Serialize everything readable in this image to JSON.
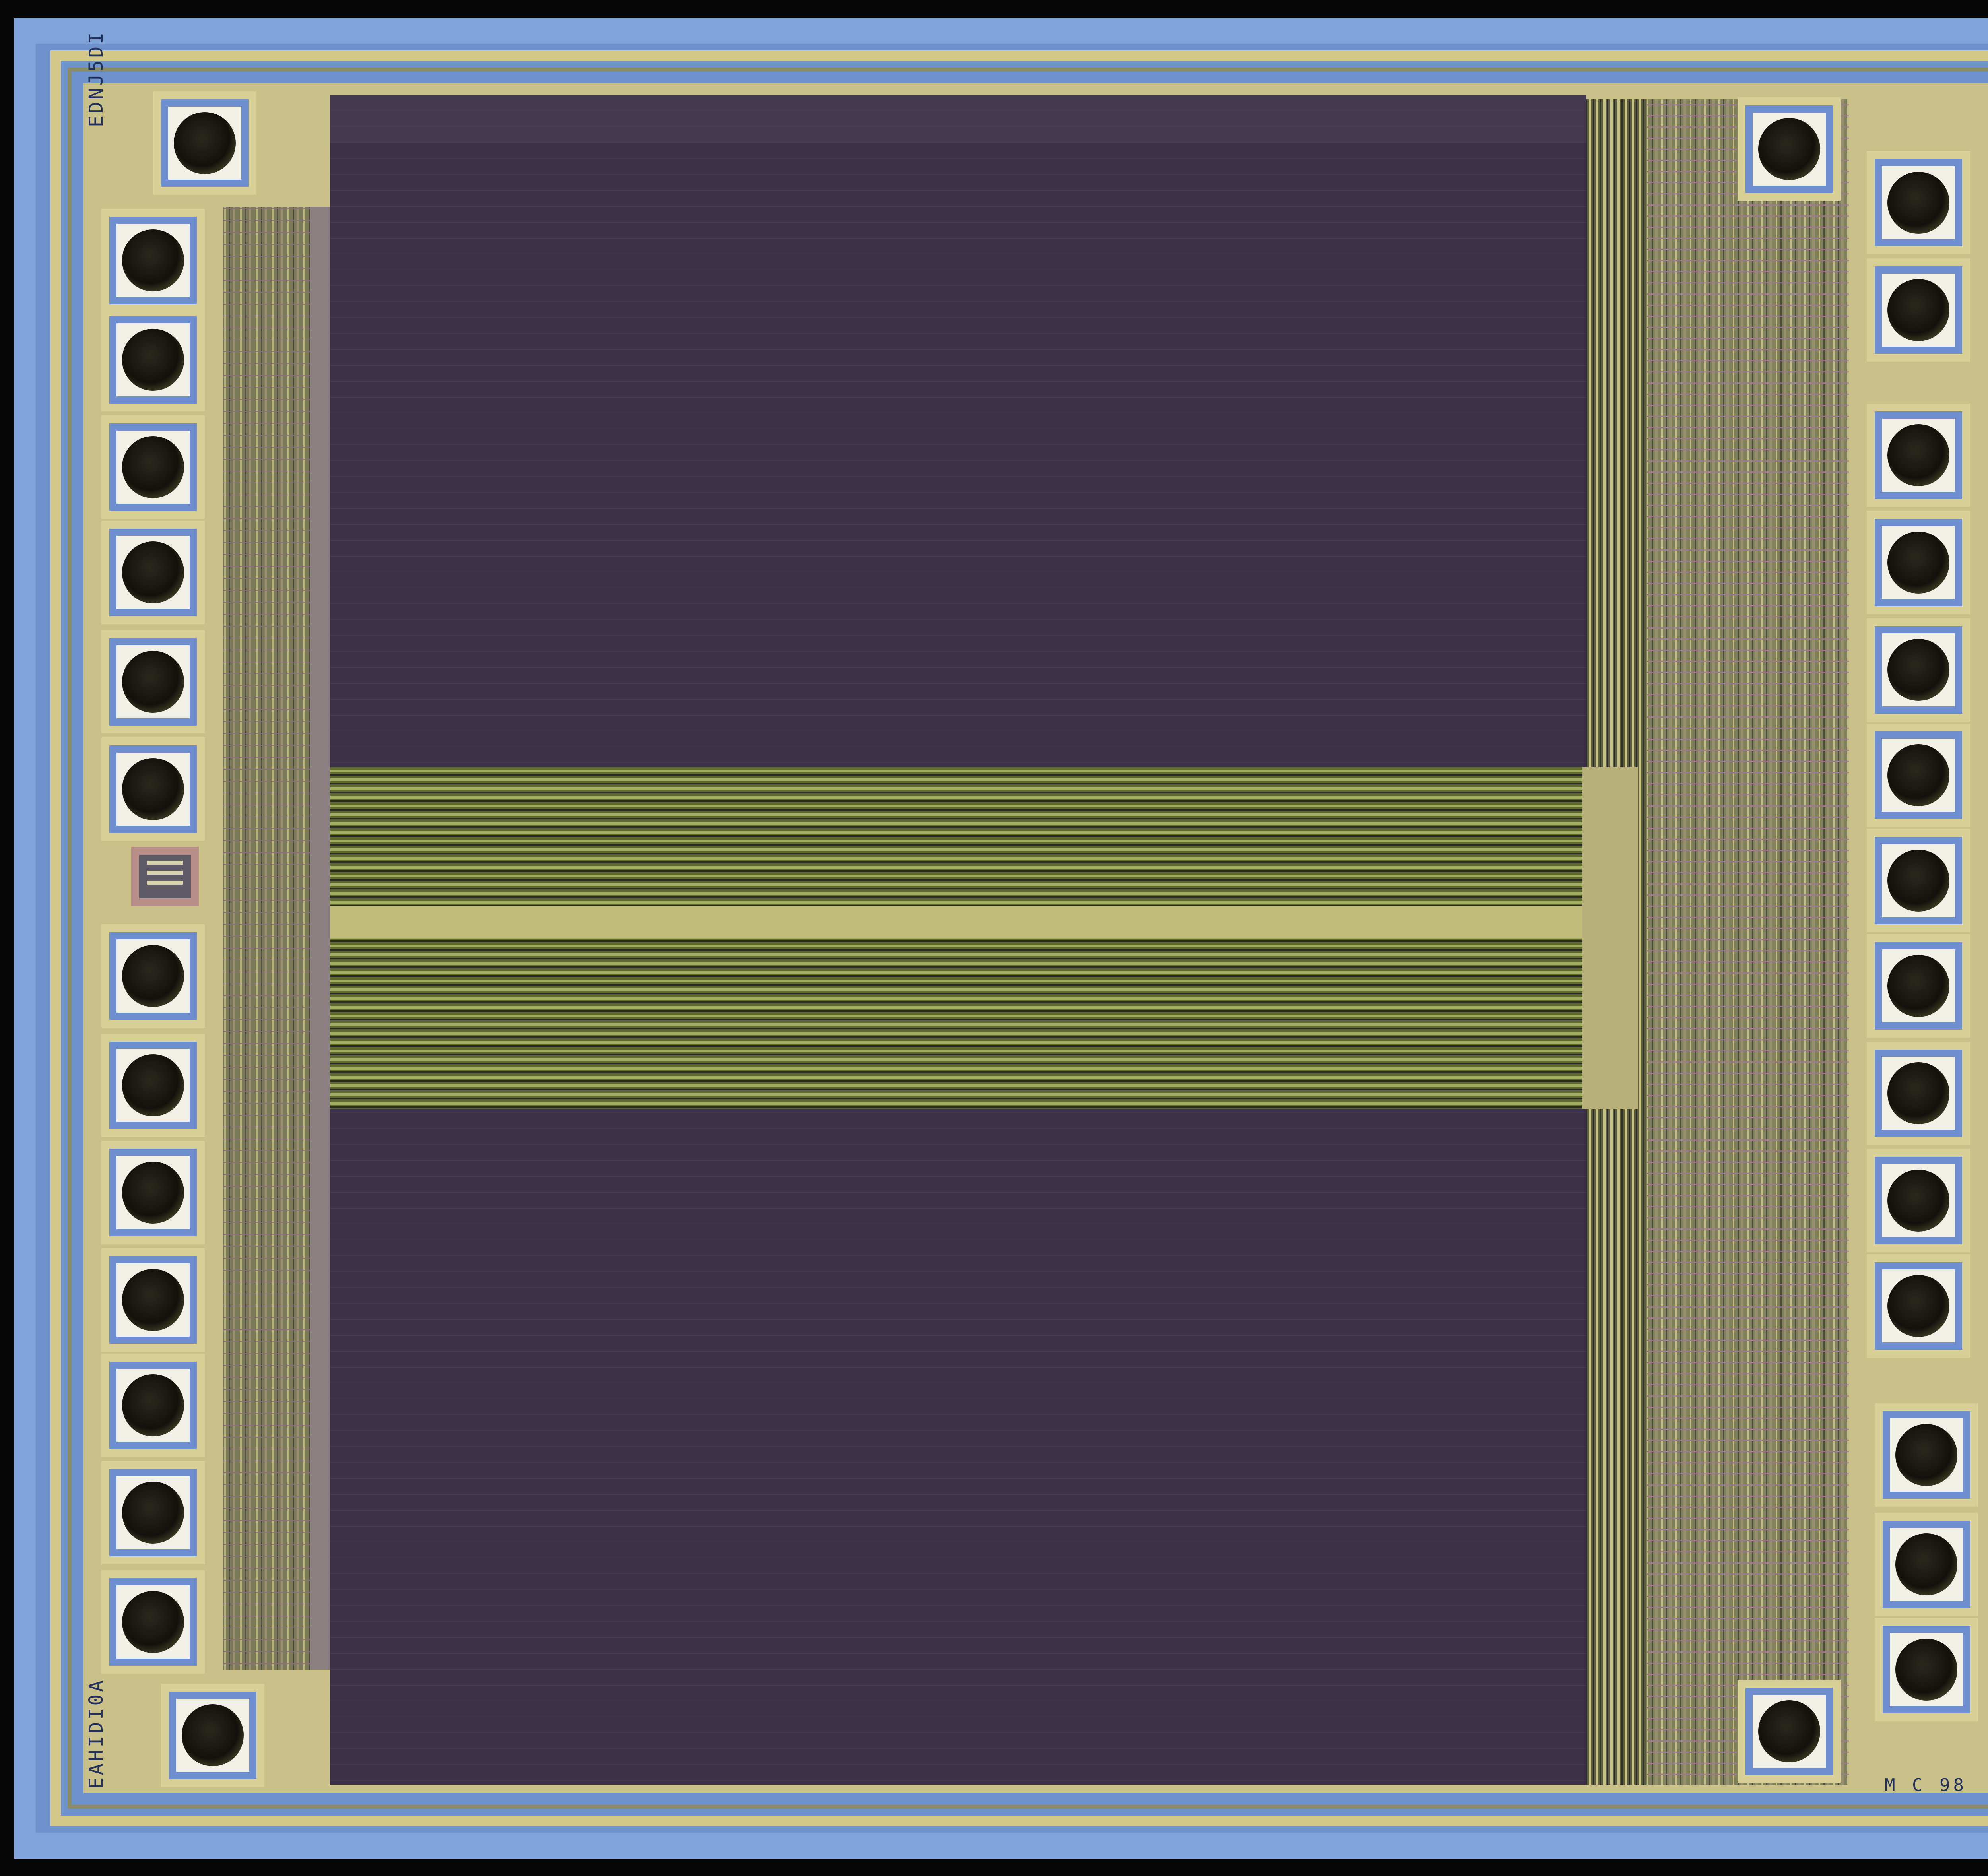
{
  "die_markings": {
    "top_left": "EDNJ5DI",
    "bottom_left": "EAHIDI0A",
    "bottom_right_logo": "M C 98"
  },
  "colors": {
    "border_black": "#050505",
    "substrate_blue": "#7fa3d8",
    "pad_ring_gold": "#d9cf95",
    "memory_array": "#3a3048",
    "decoder_green": "#6f7a3a",
    "bond_ball": "#141410"
  },
  "pads": {
    "left_column_count": 14,
    "right_column_count": 14,
    "corner_count": 4
  }
}
